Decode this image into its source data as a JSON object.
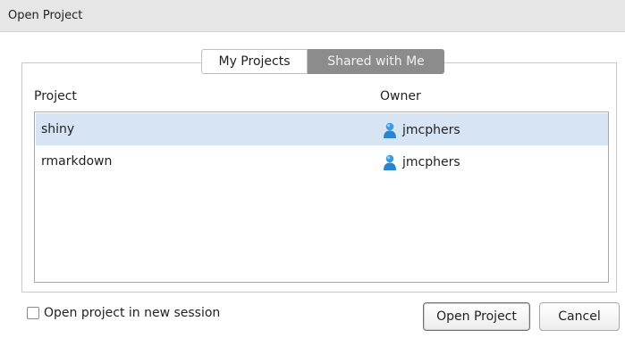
{
  "window": {
    "title": "Open Project"
  },
  "tabs": [
    {
      "label": "My Projects",
      "active": true
    },
    {
      "label": "Shared with Me",
      "active": false
    }
  ],
  "table": {
    "columns": {
      "project": "Project",
      "owner": "Owner"
    },
    "rows": [
      {
        "project": "shiny",
        "owner": "jmcphers",
        "selected": true,
        "owner_icon": "user-icon"
      },
      {
        "project": "rmarkdown",
        "owner": "jmcphers",
        "selected": false,
        "owner_icon": "user-icon"
      }
    ]
  },
  "options": {
    "new_session_label": "Open project in new session",
    "new_session_checked": false
  },
  "buttons": {
    "open": "Open Project",
    "cancel": "Cancel"
  },
  "colors": {
    "selected_row": "#d6e4f3",
    "inactive_tab": "#8c8c8c",
    "user_icon": "#2f8fd8"
  }
}
